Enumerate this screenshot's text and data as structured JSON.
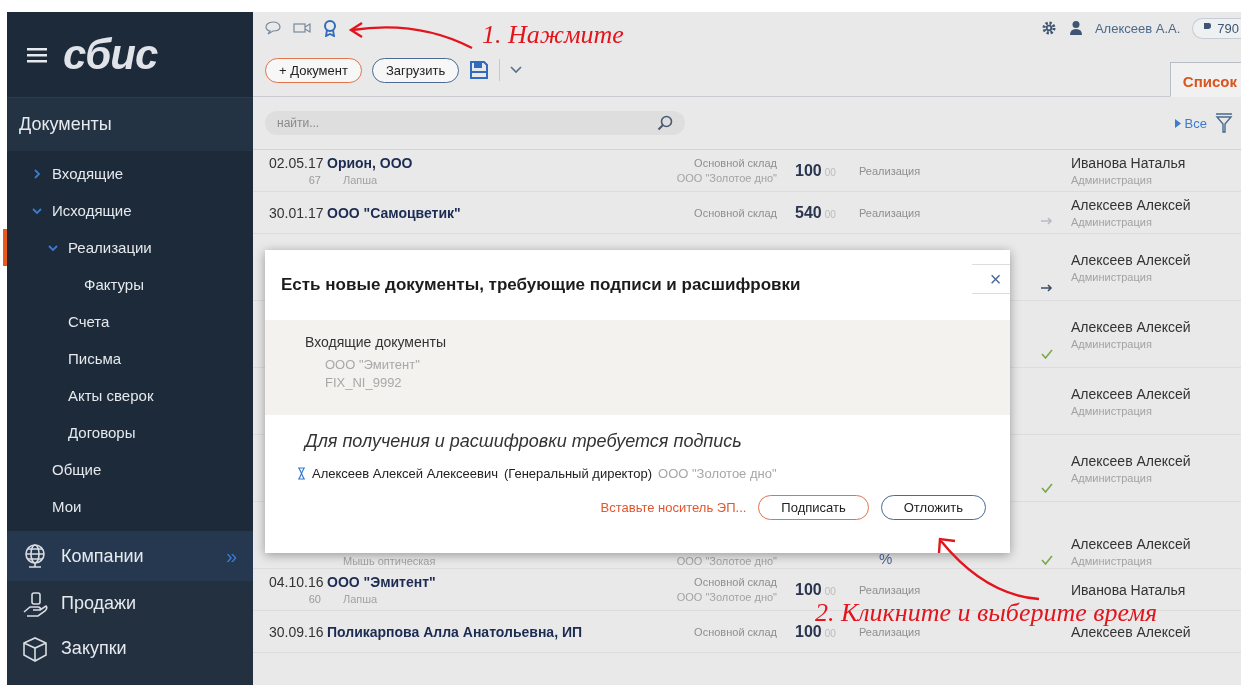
{
  "sidebar": {
    "logo": "сбис",
    "section": "Документы",
    "items": [
      {
        "label": "Входящие",
        "expanded": false,
        "selected": false
      },
      {
        "label": "Исходящие",
        "expanded": true,
        "selected": false,
        "children": [
          {
            "label": "Реализации",
            "expanded": true,
            "selected": true,
            "children": [
              {
                "label": "Фактуры",
                "selected": false
              }
            ]
          },
          {
            "label": "Счета",
            "selected": false
          },
          {
            "label": "Письма",
            "selected": false
          },
          {
            "label": "Акты сверок",
            "selected": false
          },
          {
            "label": "Договоры",
            "selected": false
          }
        ]
      },
      {
        "label": "Общие",
        "selected": false
      },
      {
        "label": "Мои",
        "selected": false
      }
    ],
    "modules": [
      {
        "label": "Компании",
        "expand": "»"
      },
      {
        "label": "Продажи"
      },
      {
        "label": "Закупки"
      }
    ]
  },
  "header": {
    "user": "Алексеев А.А.",
    "balance": "790",
    "tab": {
      "label": "Список",
      "selected": true
    },
    "buttons": [
      "+ Документ",
      "Загрузить"
    ],
    "search": {
      "placeholder": "найти..."
    },
    "filter": "Все"
  },
  "rows": [
    {
      "date": "02.05.17",
      "number": "67",
      "name": "Орион, ООО",
      "product": "Лапша",
      "warehouse": "Основной склад",
      "company": "ООО \"Золотое дно\"",
      "sum": "100",
      "cents": "00",
      "type": "Реализация",
      "sent": false,
      "signed": false,
      "person": "Иванова Наталья",
      "dept": "Администрация"
    },
    {
      "date": "30.01.17",
      "name": "ООО \"Самоцветик\"",
      "warehouse": "Основной склад",
      "sum": "540",
      "cents": "00",
      "type": "Реализация",
      "sent": true,
      "read": false,
      "signed": false,
      "person": "Алексеев Алексей",
      "dept": "Администрация"
    },
    {
      "sent": true,
      "read": true,
      "signed": false,
      "person": "Алексеев Алексей",
      "dept": "Администрация"
    },
    {
      "sent": false,
      "signed": true,
      "person": "Алексеев Алексей",
      "dept": "Администрация"
    },
    {
      "sent": false,
      "signed": false,
      "person": "Алексеев Алексей",
      "dept": "Администрация"
    },
    {
      "sent": false,
      "signed": true,
      "person": "Алексеев Алексей",
      "dept": "Администрация"
    },
    {
      "product": "Мышь оптическая",
      "company": "ООО \"Золотое дно\"",
      "extra": "%",
      "sent": false,
      "signed": true,
      "person": "Алексеев Алексей",
      "dept": "Администрация"
    },
    {
      "date": "04.10.16",
      "number": "60",
      "name": "ООО \"Эмитент\"",
      "product": "Лапша",
      "warehouse": "Основной склад",
      "company": "ООО \"Золотое дно\"",
      "sum": "100",
      "cents": "00",
      "type": "Реализация",
      "sent": false,
      "signed": false,
      "person": "Иванова Наталья"
    },
    {
      "date": "30.09.16",
      "name": "Поликарпова Алла Анатольевна, ИП",
      "warehouse": "Основной склад",
      "sum": "100",
      "cents": "00",
      "type": "Реализация",
      "sent": false,
      "signed": false,
      "person": "Алексеев Алексей"
    }
  ],
  "dialog": {
    "title": "Есть новые документы, требующие подписи и расшифровки",
    "close": "×",
    "section": "Входящие документы",
    "documents": [
      "ООО \"Эмитент\"",
      "FIX_NI_9992"
    ],
    "prompt": "Для получения и расшифровки требуется подпись",
    "signer": {
      "name": "Алексеев Алексей Алексеевич",
      "role": "(Генеральный директор)",
      "company": "ООО \"Золотое дно\""
    },
    "link": "Вставьте носитель ЭП...",
    "buttons": [
      "Подписать",
      "Отложить"
    ]
  },
  "annotations": [
    "1. Нажмите",
    "2. Кликните и выберите время"
  ]
}
